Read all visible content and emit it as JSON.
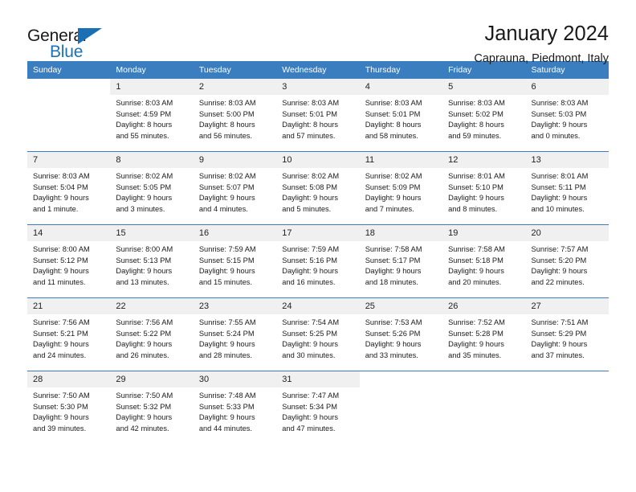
{
  "brand": {
    "name_part1": "General",
    "name_part2": "Blue",
    "flag_icon": "triangle-flag-icon",
    "accent_color": "#1b72b8"
  },
  "header": {
    "title": "January 2024",
    "subtitle": "Caprauna, Piedmont, Italy"
  },
  "theme": {
    "header_row_bg": "#3a7ebf",
    "daynum_bg": "#f0f0f0",
    "text_color": "#1a1a1a"
  },
  "weekday_headers": [
    "Sunday",
    "Monday",
    "Tuesday",
    "Wednesday",
    "Thursday",
    "Friday",
    "Saturday"
  ],
  "weeks": [
    [
      {
        "day": "",
        "sunrise": "",
        "sunset": "",
        "daylight_line1": "",
        "daylight_line2": ""
      },
      {
        "day": "1",
        "sunrise": "Sunrise: 8:03 AM",
        "sunset": "Sunset: 4:59 PM",
        "daylight_line1": "Daylight: 8 hours",
        "daylight_line2": "and 55 minutes."
      },
      {
        "day": "2",
        "sunrise": "Sunrise: 8:03 AM",
        "sunset": "Sunset: 5:00 PM",
        "daylight_line1": "Daylight: 8 hours",
        "daylight_line2": "and 56 minutes."
      },
      {
        "day": "3",
        "sunrise": "Sunrise: 8:03 AM",
        "sunset": "Sunset: 5:01 PM",
        "daylight_line1": "Daylight: 8 hours",
        "daylight_line2": "and 57 minutes."
      },
      {
        "day": "4",
        "sunrise": "Sunrise: 8:03 AM",
        "sunset": "Sunset: 5:01 PM",
        "daylight_line1": "Daylight: 8 hours",
        "daylight_line2": "and 58 minutes."
      },
      {
        "day": "5",
        "sunrise": "Sunrise: 8:03 AM",
        "sunset": "Sunset: 5:02 PM",
        "daylight_line1": "Daylight: 8 hours",
        "daylight_line2": "and 59 minutes."
      },
      {
        "day": "6",
        "sunrise": "Sunrise: 8:03 AM",
        "sunset": "Sunset: 5:03 PM",
        "daylight_line1": "Daylight: 9 hours",
        "daylight_line2": "and 0 minutes."
      }
    ],
    [
      {
        "day": "7",
        "sunrise": "Sunrise: 8:03 AM",
        "sunset": "Sunset: 5:04 PM",
        "daylight_line1": "Daylight: 9 hours",
        "daylight_line2": "and 1 minute."
      },
      {
        "day": "8",
        "sunrise": "Sunrise: 8:02 AM",
        "sunset": "Sunset: 5:05 PM",
        "daylight_line1": "Daylight: 9 hours",
        "daylight_line2": "and 3 minutes."
      },
      {
        "day": "9",
        "sunrise": "Sunrise: 8:02 AM",
        "sunset": "Sunset: 5:07 PM",
        "daylight_line1": "Daylight: 9 hours",
        "daylight_line2": "and 4 minutes."
      },
      {
        "day": "10",
        "sunrise": "Sunrise: 8:02 AM",
        "sunset": "Sunset: 5:08 PM",
        "daylight_line1": "Daylight: 9 hours",
        "daylight_line2": "and 5 minutes."
      },
      {
        "day": "11",
        "sunrise": "Sunrise: 8:02 AM",
        "sunset": "Sunset: 5:09 PM",
        "daylight_line1": "Daylight: 9 hours",
        "daylight_line2": "and 7 minutes."
      },
      {
        "day": "12",
        "sunrise": "Sunrise: 8:01 AM",
        "sunset": "Sunset: 5:10 PM",
        "daylight_line1": "Daylight: 9 hours",
        "daylight_line2": "and 8 minutes."
      },
      {
        "day": "13",
        "sunrise": "Sunrise: 8:01 AM",
        "sunset": "Sunset: 5:11 PM",
        "daylight_line1": "Daylight: 9 hours",
        "daylight_line2": "and 10 minutes."
      }
    ],
    [
      {
        "day": "14",
        "sunrise": "Sunrise: 8:00 AM",
        "sunset": "Sunset: 5:12 PM",
        "daylight_line1": "Daylight: 9 hours",
        "daylight_line2": "and 11 minutes."
      },
      {
        "day": "15",
        "sunrise": "Sunrise: 8:00 AM",
        "sunset": "Sunset: 5:13 PM",
        "daylight_line1": "Daylight: 9 hours",
        "daylight_line2": "and 13 minutes."
      },
      {
        "day": "16",
        "sunrise": "Sunrise: 7:59 AM",
        "sunset": "Sunset: 5:15 PM",
        "daylight_line1": "Daylight: 9 hours",
        "daylight_line2": "and 15 minutes."
      },
      {
        "day": "17",
        "sunrise": "Sunrise: 7:59 AM",
        "sunset": "Sunset: 5:16 PM",
        "daylight_line1": "Daylight: 9 hours",
        "daylight_line2": "and 16 minutes."
      },
      {
        "day": "18",
        "sunrise": "Sunrise: 7:58 AM",
        "sunset": "Sunset: 5:17 PM",
        "daylight_line1": "Daylight: 9 hours",
        "daylight_line2": "and 18 minutes."
      },
      {
        "day": "19",
        "sunrise": "Sunrise: 7:58 AM",
        "sunset": "Sunset: 5:18 PM",
        "daylight_line1": "Daylight: 9 hours",
        "daylight_line2": "and 20 minutes."
      },
      {
        "day": "20",
        "sunrise": "Sunrise: 7:57 AM",
        "sunset": "Sunset: 5:20 PM",
        "daylight_line1": "Daylight: 9 hours",
        "daylight_line2": "and 22 minutes."
      }
    ],
    [
      {
        "day": "21",
        "sunrise": "Sunrise: 7:56 AM",
        "sunset": "Sunset: 5:21 PM",
        "daylight_line1": "Daylight: 9 hours",
        "daylight_line2": "and 24 minutes."
      },
      {
        "day": "22",
        "sunrise": "Sunrise: 7:56 AM",
        "sunset": "Sunset: 5:22 PM",
        "daylight_line1": "Daylight: 9 hours",
        "daylight_line2": "and 26 minutes."
      },
      {
        "day": "23",
        "sunrise": "Sunrise: 7:55 AM",
        "sunset": "Sunset: 5:24 PM",
        "daylight_line1": "Daylight: 9 hours",
        "daylight_line2": "and 28 minutes."
      },
      {
        "day": "24",
        "sunrise": "Sunrise: 7:54 AM",
        "sunset": "Sunset: 5:25 PM",
        "daylight_line1": "Daylight: 9 hours",
        "daylight_line2": "and 30 minutes."
      },
      {
        "day": "25",
        "sunrise": "Sunrise: 7:53 AM",
        "sunset": "Sunset: 5:26 PM",
        "daylight_line1": "Daylight: 9 hours",
        "daylight_line2": "and 33 minutes."
      },
      {
        "day": "26",
        "sunrise": "Sunrise: 7:52 AM",
        "sunset": "Sunset: 5:28 PM",
        "daylight_line1": "Daylight: 9 hours",
        "daylight_line2": "and 35 minutes."
      },
      {
        "day": "27",
        "sunrise": "Sunrise: 7:51 AM",
        "sunset": "Sunset: 5:29 PM",
        "daylight_line1": "Daylight: 9 hours",
        "daylight_line2": "and 37 minutes."
      }
    ],
    [
      {
        "day": "28",
        "sunrise": "Sunrise: 7:50 AM",
        "sunset": "Sunset: 5:30 PM",
        "daylight_line1": "Daylight: 9 hours",
        "daylight_line2": "and 39 minutes."
      },
      {
        "day": "29",
        "sunrise": "Sunrise: 7:50 AM",
        "sunset": "Sunset: 5:32 PM",
        "daylight_line1": "Daylight: 9 hours",
        "daylight_line2": "and 42 minutes."
      },
      {
        "day": "30",
        "sunrise": "Sunrise: 7:48 AM",
        "sunset": "Sunset: 5:33 PM",
        "daylight_line1": "Daylight: 9 hours",
        "daylight_line2": "and 44 minutes."
      },
      {
        "day": "31",
        "sunrise": "Sunrise: 7:47 AM",
        "sunset": "Sunset: 5:34 PM",
        "daylight_line1": "Daylight: 9 hours",
        "daylight_line2": "and 47 minutes."
      },
      {
        "day": "",
        "sunrise": "",
        "sunset": "",
        "daylight_line1": "",
        "daylight_line2": ""
      },
      {
        "day": "",
        "sunrise": "",
        "sunset": "",
        "daylight_line1": "",
        "daylight_line2": ""
      },
      {
        "day": "",
        "sunrise": "",
        "sunset": "",
        "daylight_line1": "",
        "daylight_line2": ""
      }
    ]
  ]
}
